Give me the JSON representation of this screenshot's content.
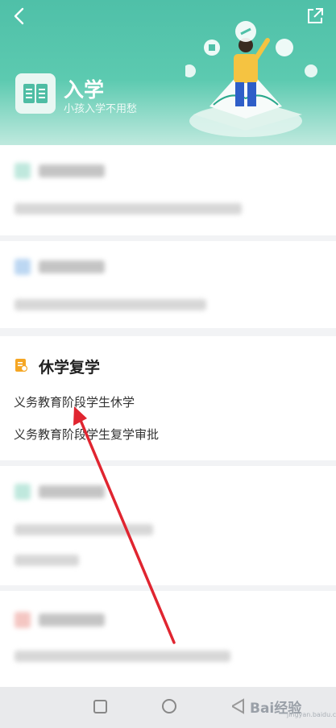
{
  "header": {
    "title": "入学",
    "subtitle": "小孩入学不用愁"
  },
  "section": {
    "title": "休学复学",
    "links": [
      "义务教育阶段学生休学",
      "义务教育阶段学生复学审批"
    ]
  },
  "watermark": {
    "brand": "Bai经验",
    "sub": "jingyan.baidu.com"
  },
  "colors": {
    "header_green": "#4fc0a8",
    "annotation_red": "#e02530",
    "section_icon_orange": "#f5a623"
  }
}
